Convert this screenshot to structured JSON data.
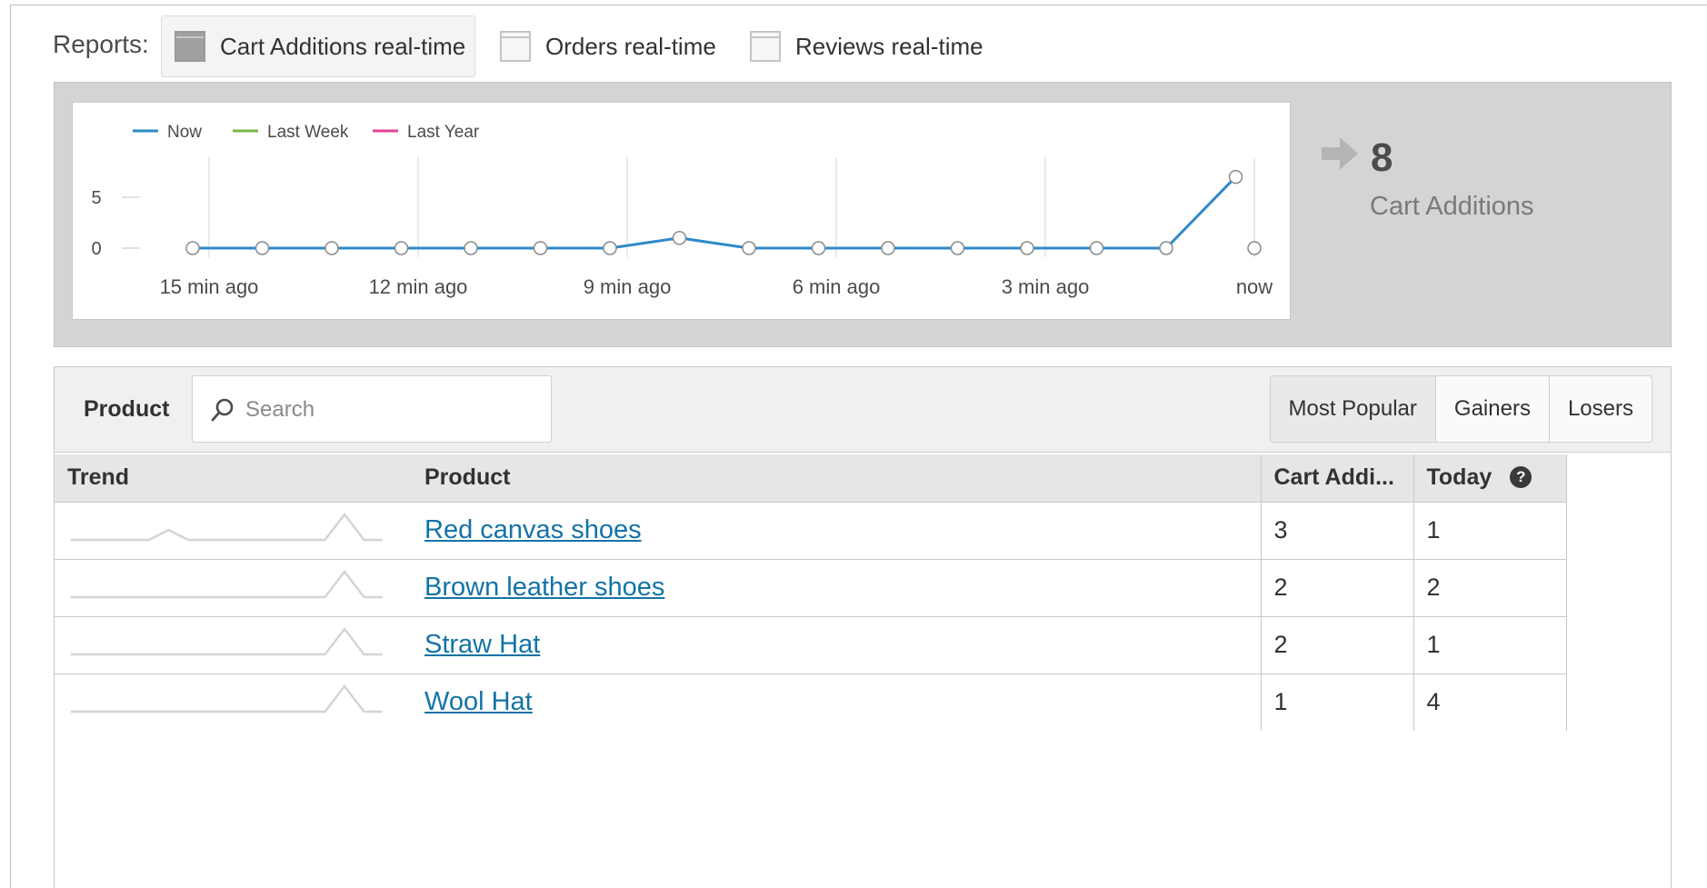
{
  "reports": {
    "label": "Reports:",
    "tabs": [
      {
        "label": "Cart Additions real-time",
        "active": true,
        "icon": "report-icon"
      },
      {
        "label": "Orders real-time",
        "active": false,
        "icon": "report-icon"
      },
      {
        "label": "Reviews real-time",
        "active": false,
        "icon": "report-icon"
      }
    ]
  },
  "chart_data": {
    "type": "line",
    "legend": [
      "Now",
      "Last Week",
      "Last Year"
    ],
    "legend_placement": "top-left",
    "colors": {
      "Now": "#2f8ac9",
      "Last Week": "#7ab648",
      "Last Year": "#e0449a"
    },
    "x_ticks": [
      "15 min ago",
      "12 min ago",
      "9 min ago",
      "6 min ago",
      "3 min ago",
      "now"
    ],
    "y_ticks": [
      "5",
      "0"
    ],
    "ylim": [
      0,
      5
    ],
    "grid": true,
    "series": [
      {
        "name": "Now",
        "values": [
          0,
          0,
          0,
          0,
          0,
          0,
          0,
          1,
          0,
          0,
          0,
          0,
          0,
          0,
          0,
          7
        ]
      }
    ],
    "trailing_empty_point": 0
  },
  "summary": {
    "value": "8",
    "label": "Cart Additions"
  },
  "table": {
    "dimension_label": "Product",
    "search_placeholder": "Search",
    "segments": [
      "Most Popular",
      "Gainers",
      "Losers"
    ],
    "columns": {
      "trend": "Trend",
      "product": "Product",
      "cart": "Cart Addi...",
      "today": "Today"
    },
    "help_icon": "?",
    "rows": [
      {
        "product": "Red canvas shoes",
        "cart": "3",
        "today": "1",
        "trend": [
          0,
          0,
          0,
          0,
          0,
          1,
          0,
          0,
          0,
          0,
          0,
          0,
          0,
          0,
          1,
          0
        ]
      },
      {
        "product": "Brown leather shoes",
        "cart": "2",
        "today": "2",
        "trend": [
          0,
          0,
          0,
          0,
          0,
          0,
          0,
          0,
          0,
          0,
          0,
          0,
          0,
          0,
          1,
          0
        ]
      },
      {
        "product": "Straw Hat",
        "cart": "2",
        "today": "1",
        "trend": [
          0,
          0,
          0,
          0,
          0,
          0,
          0,
          0,
          0,
          0,
          0,
          0,
          0,
          0,
          1,
          0
        ]
      },
      {
        "product": "Wool Hat",
        "cart": "1",
        "today": "4",
        "trend": [
          0,
          0,
          0,
          0,
          0,
          0,
          0,
          0,
          0,
          0,
          0,
          0,
          0,
          0,
          1,
          0
        ]
      }
    ]
  }
}
